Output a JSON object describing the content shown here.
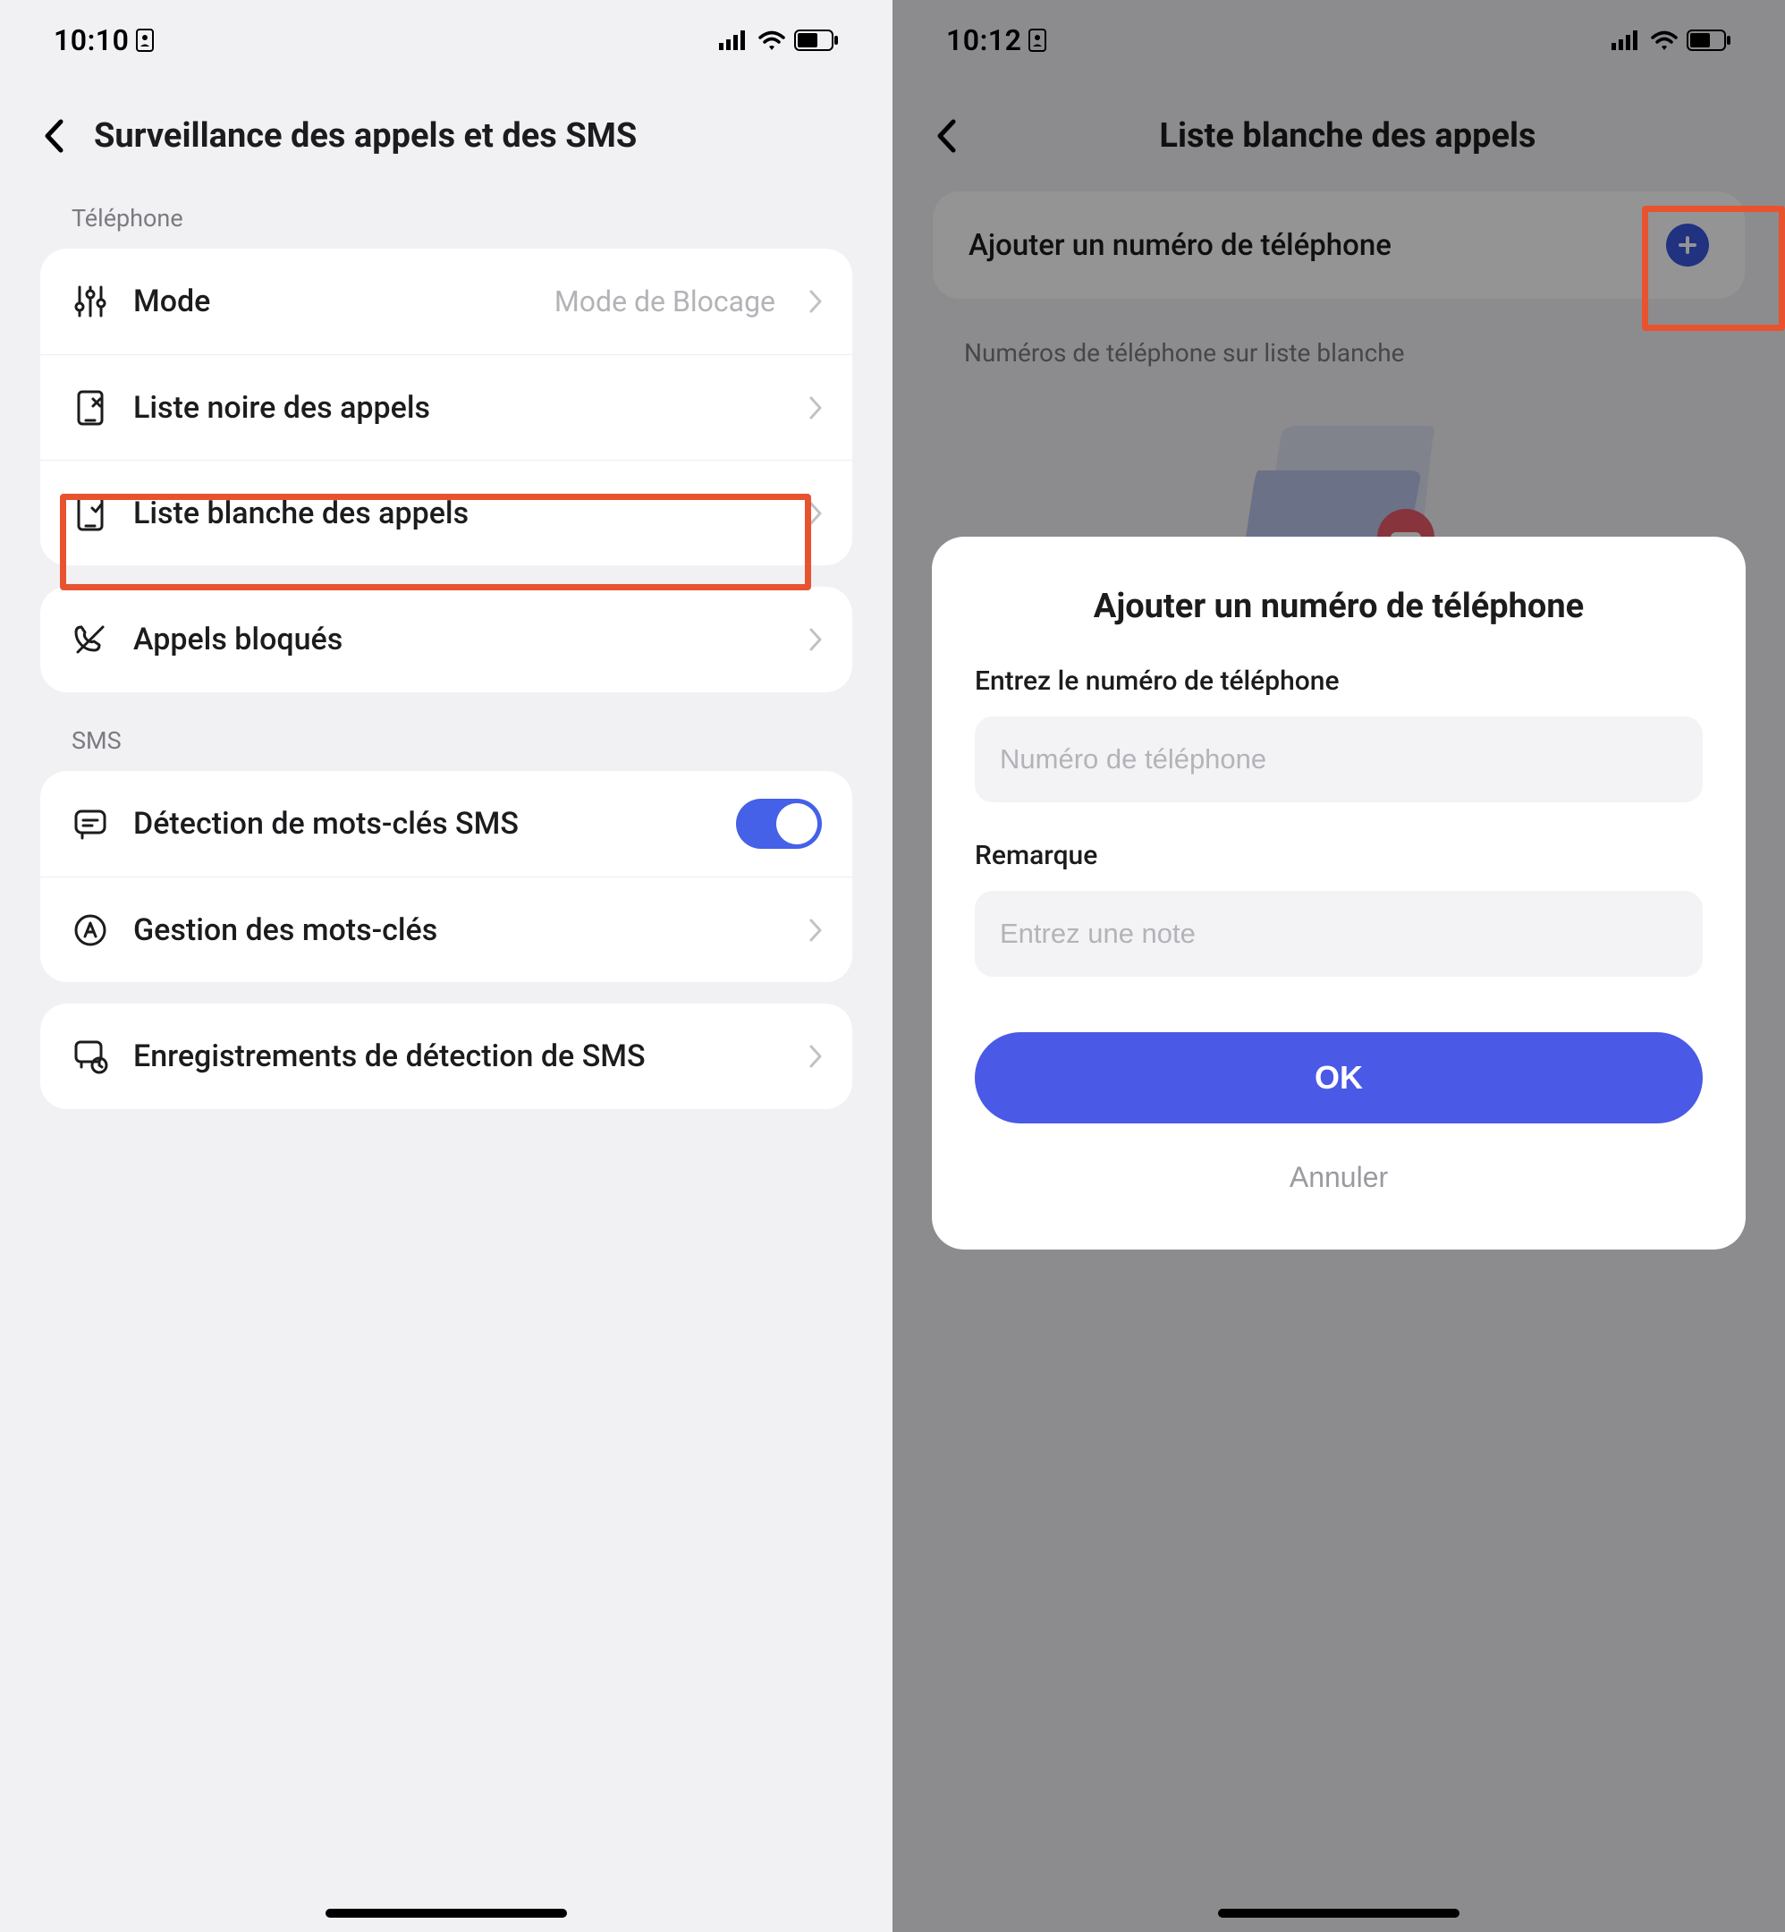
{
  "screen1": {
    "status_time": "10:10",
    "title": "Surveillance des appels et des SMS",
    "sections": {
      "phone_label": "Téléphone",
      "sms_label": "SMS"
    },
    "rows": {
      "mode": {
        "label": "Mode",
        "value": "Mode de Blocage"
      },
      "blacklist": {
        "label": "Liste noire des appels"
      },
      "whitelist": {
        "label": "Liste blanche des appels"
      },
      "blocked": {
        "label": "Appels bloqués"
      },
      "sms_detect": {
        "label": "Détection de mots-clés SMS",
        "toggle": true
      },
      "keywords": {
        "label": "Gestion des mots-clés"
      },
      "sms_records": {
        "label": "Enregistrements de détection de SMS"
      }
    }
  },
  "screen2": {
    "status_time": "10:12",
    "title": "Liste blanche des appels",
    "add_row_label": "Ajouter un numéro de téléphone",
    "list_label": "Numéros de téléphone sur liste blanche",
    "dialog": {
      "title": "Ajouter un numéro de téléphone",
      "phone_label": "Entrez le numéro de téléphone",
      "phone_placeholder": "Numéro de téléphone",
      "note_label": "Remarque",
      "note_placeholder": "Entrez une note",
      "ok": "OK",
      "cancel": "Annuler"
    }
  }
}
